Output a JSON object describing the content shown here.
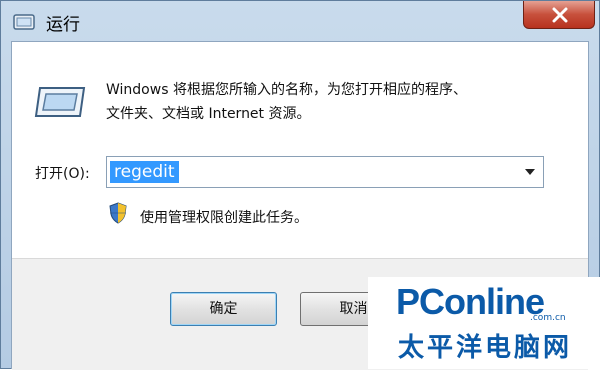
{
  "window": {
    "title": "运行",
    "icons": {
      "title": "run-icon",
      "close": "close-icon",
      "main": "run-dialog-icon",
      "shield": "uac-shield-icon",
      "dropdown": "chevron-down-icon"
    }
  },
  "dialog": {
    "description_line1": "Windows 将根据您所输入的名称，为您打开相应的程序、",
    "description_line2": "文件夹、文档或 Internet 资源。",
    "open_label": "打开(O):",
    "open_value": "regedit",
    "admin_note": "使用管理权限创建此任务。"
  },
  "buttons": {
    "ok": "确定",
    "cancel": "取消"
  },
  "watermark": {
    "logo": "PConline",
    "domain": ".com.cn",
    "chinese": "太平洋电脑网"
  },
  "colors": {
    "selection": "#3399ff",
    "close_button": "#c7503c",
    "brand": "#0b5aa8"
  }
}
